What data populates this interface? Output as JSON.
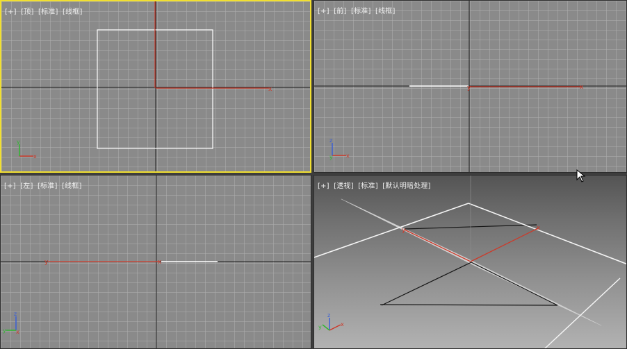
{
  "viewports": {
    "top": {
      "label": [
        "[+]",
        "[顶]",
        "[标准]",
        "[线框]"
      ]
    },
    "front": {
      "label": [
        "[+]",
        "[前]",
        "[标准]",
        "[线框]"
      ]
    },
    "left": {
      "label": [
        "[+]",
        "[左]",
        "[标准]",
        "[线框]"
      ]
    },
    "perspective": {
      "label": [
        "[+]",
        "[透视]",
        "[标准]",
        "[默认明暗处理]"
      ]
    }
  },
  "axis_tripod_labels": {
    "x": "x",
    "y": "y",
    "z": "z"
  },
  "colors": {
    "active_border": "#f2e030",
    "viewport_bg": "#8a8a8a",
    "x_axis": "#cc3a2a",
    "y_axis_gizmo": "#2fb82f",
    "z_axis_gizmo": "#3a5fd6",
    "selection": "#ffffff"
  }
}
